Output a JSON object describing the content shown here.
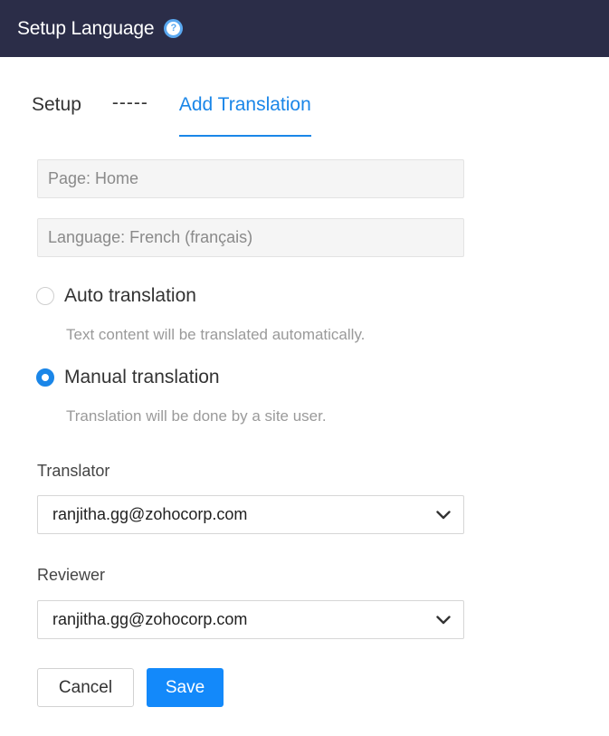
{
  "header": {
    "title": "Setup Language",
    "help_icon": "help-icon"
  },
  "tabs": [
    {
      "label": "Setup"
    },
    {
      "label": "-----"
    },
    {
      "label": "Add Translation",
      "active": true
    }
  ],
  "fields": {
    "page": "Page: Home",
    "language": "Language: French (français)"
  },
  "options": {
    "auto": {
      "label": "Auto translation",
      "description": "Text content will be translated automatically.",
      "selected": false
    },
    "manual": {
      "label": "Manual translation",
      "description": "Translation will be done by a site user.",
      "selected": true
    }
  },
  "translator": {
    "label": "Translator",
    "value": "ranjitha.gg@zohocorp.com"
  },
  "reviewer": {
    "label": "Reviewer",
    "value": "ranjitha.gg@zohocorp.com"
  },
  "buttons": {
    "cancel": "Cancel",
    "save": "Save"
  },
  "colors": {
    "header_bg": "#2b2d48",
    "accent": "#1a86e8",
    "save_bg": "#1389fa"
  }
}
